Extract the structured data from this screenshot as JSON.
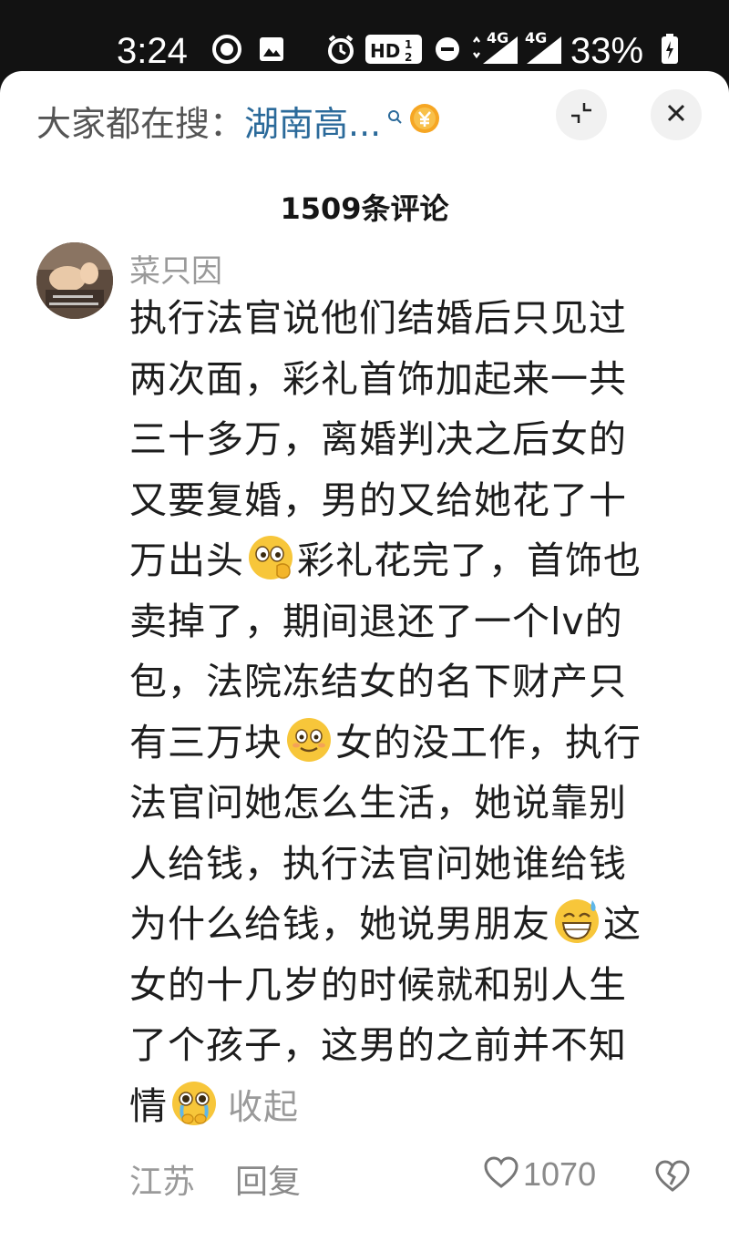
{
  "status_bar": {
    "time": "3:24",
    "network_1": "4G",
    "network_2": "4G",
    "hd_label": "HD",
    "battery": "33%",
    "icons": [
      "record-icon",
      "image-icon",
      "alarm-icon",
      "hd-icon",
      "do-not-disturb-icon",
      "signal-icon",
      "signal-icon",
      "battery-icon"
    ]
  },
  "search": {
    "prefix": "大家都在搜：",
    "query": "湖南高...",
    "icons": [
      "search-icon",
      "coin-icon"
    ]
  },
  "header": {
    "comment_count": "1509条评论",
    "actions": [
      "minimize-icon",
      "close-icon"
    ]
  },
  "comment": {
    "author": "菜只因",
    "lines": [
      {
        "t1": "执行法官说他们结婚后只见过"
      },
      {
        "t1": "两次面，彩礼首饰加起来一共"
      },
      {
        "t1": "三十多万，离婚判决之后女的"
      },
      {
        "t1": "又要复婚，男的又给她花了十"
      },
      {
        "t1": "万出头",
        "emoji": "peeking-face-emoji",
        "t2": "彩礼花完了，首饰也"
      },
      {
        "t1": "卖掉了，期间退还了一个lv的"
      },
      {
        "t1": "包，法院冻结女的名下财产只"
      },
      {
        "t1": "有三万块",
        "emoji": "smiling-face-emoji",
        "t2": "女的没工作，执行"
      },
      {
        "t1": "法官问她怎么生活，她说靠别"
      },
      {
        "t1": "人给钱，执行法官问她谁给钱"
      },
      {
        "t1": "为什么给钱，她说男朋友",
        "emoji": "grinning-sweat-emoji",
        "t2": "这"
      },
      {
        "t1": "女的十几岁的时候就和别人生"
      },
      {
        "t1": "了个孩子，这男的之前并不知"
      },
      {
        "t1": "情",
        "emoji": "crying-face-emoji",
        "t2": ""
      }
    ],
    "collapse_label": "收起",
    "location": "江苏",
    "reply_label": "回复",
    "like_count": "1070"
  },
  "colors": {
    "search_query": "#2b6a9a",
    "meta_gray": "#9a9a9a",
    "emoji_yellow": "#f7c63a"
  }
}
